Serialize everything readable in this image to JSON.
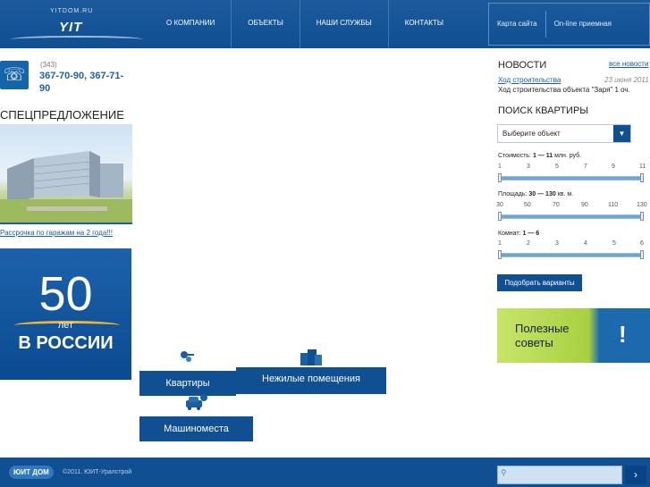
{
  "header": {
    "logo_url": "YITDOM.RU",
    "logo_mark": "YIT",
    "nav": [
      "О КОМПАНИИ",
      "ОБЪЕКТЫ",
      "НАШИ СЛУЖБЫ",
      "КОНТАКТЫ"
    ],
    "sitemap": "Карта сайта",
    "reception": "On-line приемная"
  },
  "contacts": {
    "code": "(343)",
    "numbers": "367-70-90, 367-71-90"
  },
  "special": {
    "title": "СПЕЦПРЕДЛОЖЕНИЕ",
    "link": "Рассрочка по гаражам на 2 года!!!"
  },
  "banner": {
    "number": "50",
    "let": "лет",
    "country": "В РОССИИ"
  },
  "categories": {
    "apartments": "Квартиры",
    "commercial": "Нежилые помещения",
    "parking": "Машиноместа"
  },
  "news": {
    "title": "НОВОСТИ",
    "all": "все новости",
    "item_link": "Ход строительства",
    "item_date": "23 июня 2011",
    "item_text": "Ход строительства объекта \"Заря\" 1 оч."
  },
  "search": {
    "title": "ПОИСК КВАРТИРЫ",
    "select_value": "Выберите объект",
    "price_label": "Стоимость:",
    "price_range": "1 — 11",
    "price_unit": "млн. руб.",
    "price_ticks": [
      "1",
      "3",
      "5",
      "7",
      "9",
      "11"
    ],
    "area_label": "Площадь:",
    "area_range": "30 — 130",
    "area_unit": "кв. м.",
    "area_ticks": [
      "30",
      "50",
      "70",
      "90",
      "110",
      "130"
    ],
    "rooms_label": "Комнат:",
    "rooms_range": "1 — 6",
    "rooms_ticks": [
      "1",
      "2",
      "3",
      "4",
      "5",
      "6"
    ],
    "submit": "Подобрать варианты"
  },
  "advice": {
    "line1": "Полезные",
    "line2": "советы",
    "mark": "!"
  },
  "footer": {
    "logo": "ЮИТ ДОМ",
    "copyright": "©2011. ЮИТ-Уралстрой",
    "search_button": "›"
  },
  "icons": {
    "phone": "phone-icon",
    "search": "search-icon"
  }
}
